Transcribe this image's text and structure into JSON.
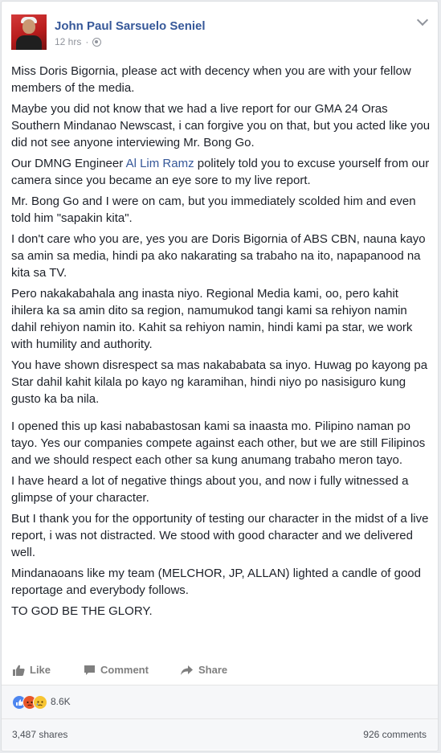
{
  "post": {
    "author": "John Paul Sarsuelo Seniel",
    "time": "12 hrs",
    "separator": "·",
    "privacy_icon": "globe-icon",
    "paragraphs": {
      "p1": "Miss Doris Bigornia, please act with decency when you are with your fellow members of the media.",
      "p2": "Maybe you did not know that we had a live report for our GMA 24 Oras Southern Mindanao Newscast, i can forgive you on that, but you acted like you did not see anyone interviewing Mr. Bong Go.",
      "p3_before": "Our DMNG Engineer ",
      "p3_link": "Al Lim Ramz",
      "p3_after": " politely told you to excuse yourself from our camera since you became an eye sore to my live report.",
      "p4": "Mr. Bong Go and I were on cam, but you immediately scolded him and even told him \"sapakin kita\".",
      "p5": "I don't care who you are, yes you are Doris Bigornia of ABS CBN, nauna kayo sa amin sa media, hindi pa ako nakarating sa trabaho na ito, napapanood na kita sa TV.",
      "p6": "Pero nakakabahala ang inasta niyo. Regional Media kami, oo, pero kahit ihilera ka sa amin dito sa region, namumukod tangi kami sa rehiyon namin dahil rehiyon namin ito. Kahit sa rehiyon namin, hindi kami pa star, we work with humility and authority.",
      "p7": "You have shown disrespect sa mas nakababata sa inyo. Huwag po kayong pa Star dahil kahit kilala po kayo ng karamihan, hindi niyo po nasisiguro kung gusto ka ba nila.",
      "p8": "I opened this up kasi nababastosan kami sa inaasta mo. Pilipino naman po tayo. Yes our companies compete against each other, but we are still Filipinos and we should respect each other sa kung anumang trabaho meron tayo.",
      "p9": "I have heard a lot of negative things about you, and now i fully witnessed a glimpse of your character.",
      "p10": "But I thank you for the opportunity of testing our character in the midst of a live report, i was not distracted. We stood with good character and we delivered well.",
      "p11": "Mindanaoans like my team (MELCHOR, JP, ALLAN) lighted a candle of good reportage and everybody follows.",
      "p12": "TO GOD BE THE GLORY."
    }
  },
  "actions": {
    "like": "Like",
    "comment": "Comment",
    "share": "Share"
  },
  "reactions": {
    "icons": [
      "like-reaction-icon",
      "angry-reaction-icon",
      "sad-reaction-icon"
    ],
    "count": "8.6K"
  },
  "stats": {
    "shares": "3,487 shares",
    "comments": "926 comments"
  },
  "colors": {
    "link": "#365899",
    "muted": "#90949c",
    "like_reaction": "#4e86ef",
    "angry_reaction": "#e8562a",
    "sad_reaction": "#f7c533"
  }
}
